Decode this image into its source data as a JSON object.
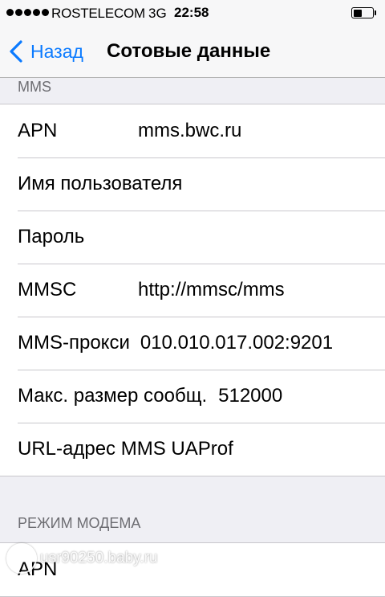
{
  "status_bar": {
    "carrier": "ROSTELECOM",
    "network": "3G",
    "time": "22:58",
    "battery_level": 0.5
  },
  "nav": {
    "back_label": "Назад",
    "title": "Сотовые данные",
    "accent_color": "#0a7aff"
  },
  "mms_section": {
    "header": "MMS",
    "rows": [
      {
        "label": "APN",
        "value": "mms.bwc.ru"
      },
      {
        "label": "Имя пользователя",
        "value": ""
      },
      {
        "label": "Пароль",
        "value": ""
      },
      {
        "label": "MMSC",
        "value": "http://mmsc/mms"
      },
      {
        "label": "MMS-прокси",
        "value": "010.010.017.002:9201"
      },
      {
        "label": "Макс. размер сообщ.",
        "value": "512000"
      },
      {
        "label": "URL-адрес MMS UAProf",
        "value": ""
      }
    ]
  },
  "modem_section": {
    "header": "РЕЖИМ МОДЕМА",
    "rows": [
      {
        "label": "APN",
        "value": ""
      }
    ]
  },
  "watermark": {
    "text": "usr90250.baby.ru"
  }
}
